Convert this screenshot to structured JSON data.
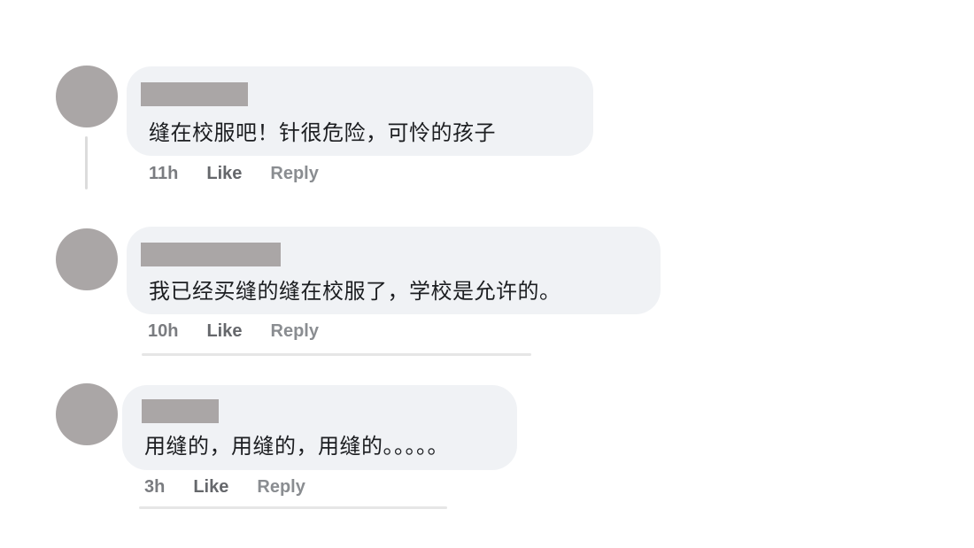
{
  "comments": [
    {
      "text": "缝在校服吧！针很危险，可怜的孩子",
      "time": "11h",
      "like_label": "Like",
      "reply_label": "Reply"
    },
    {
      "text": "我已经买缝的缝在校服了，学校是允许的。",
      "time": "10h",
      "like_label": "Like",
      "reply_label": "Reply"
    },
    {
      "text": "用缝的，用缝的，用缝的。。。。。",
      "time": "3h",
      "like_label": "Like",
      "reply_label": "Reply"
    }
  ],
  "colors": {
    "bubble": "#f0f2f5",
    "avatar_placeholder": "#aaa6a6",
    "meta_text": "#65676b"
  }
}
